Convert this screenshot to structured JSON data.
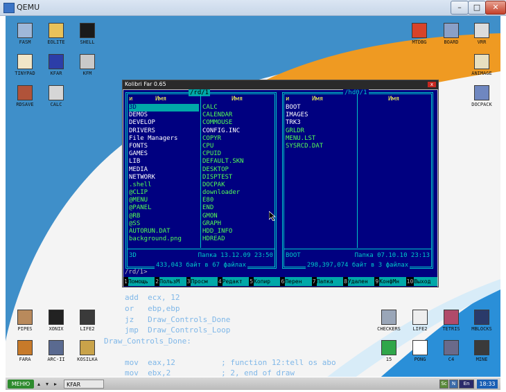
{
  "host": {
    "title": "QEMU",
    "minimize": "–",
    "maximize": "□",
    "close": "✕"
  },
  "desktop_icons": [
    {
      "label": "FASM",
      "icon": "fasm-icon",
      "color": "#9fb8d9"
    },
    {
      "label": "EOLITE",
      "icon": "folder-icon",
      "color": "#e8c25a"
    },
    {
      "label": "SHELL",
      "icon": "terminal-icon",
      "color": "#1a1a1a"
    },
    {
      "label": "TINYPAD",
      "icon": "notepad-icon",
      "color": "#f1e6c8"
    },
    {
      "label": "KFAR",
      "icon": "kfar-icon",
      "color": "#2c3ea8"
    },
    {
      "label": "KFM",
      "icon": "kfm-icon",
      "color": "#c9c9c9"
    },
    {
      "label": "RDSAVE",
      "icon": "disk-save-icon",
      "color": "#b0533a"
    },
    {
      "label": "CALC",
      "icon": "calculator-icon",
      "color": "#d6d6d6"
    },
    {
      "label": "MTDBG",
      "icon": "debugger-icon",
      "color": "#d9432a"
    },
    {
      "label": "BOARD",
      "icon": "board-icon",
      "color": "#8aa0c8"
    },
    {
      "label": "VRR",
      "icon": "monitor-icon",
      "color": "#dcdcdc"
    },
    {
      "label": "ANIMAGE",
      "icon": "paint-icon",
      "color": "#e8e0c0"
    },
    {
      "label": "DOCPACK",
      "icon": "docpack-icon",
      "color": "#6f87c0"
    },
    {
      "label": "PIPES",
      "icon": "pipes-icon",
      "color": "#b98a5c"
    },
    {
      "label": "XONIX",
      "icon": "xonix-icon",
      "color": "#222222"
    },
    {
      "label": "LIFE2",
      "icon": "life-icon",
      "color": "#3a3a3a"
    },
    {
      "label": "FARA",
      "icon": "fara-icon",
      "color": "#c77a2a"
    },
    {
      "label": "ARC-II",
      "icon": "arcanii-icon",
      "color": "#5a6a90"
    },
    {
      "label": "KOSILKA",
      "icon": "kosilka-icon",
      "color": "#c9a34a"
    },
    {
      "label": "CHECKERS",
      "icon": "checkers-icon",
      "color": "#9aa6b8"
    },
    {
      "label": "LIFE2",
      "icon": "life2-icon",
      "color": "#eeeeee"
    },
    {
      "label": "TETRIS",
      "icon": "tetris-icon",
      "color": "#b04a6a"
    },
    {
      "label": "MBLOCKS",
      "icon": "mblocks-icon",
      "color": "#2a3a6a"
    },
    {
      "label": "15",
      "icon": "fifteen-icon",
      "color": "#2fa64a"
    },
    {
      "label": "PONG",
      "icon": "pong-icon",
      "color": "#ffffff"
    },
    {
      "label": "C4",
      "icon": "c4-icon",
      "color": "#6a6a8a"
    },
    {
      "label": "MINE",
      "icon": "mine-icon",
      "color": "#3a3a3a"
    }
  ],
  "bg_code": [
    "add  ecx, 12",
    "or   ebp,ebp",
    "jz   Draw_Controls_Done",
    "jmp  Draw_Controls_Loop",
    "Draw_Controls_Done:",
    "mov  eax,12          ; function 12:tell os abo",
    "mov  ebx,2           ; 2, end of draw"
  ],
  "far": {
    "title": "Kolibri Far 0.65",
    "close": "x",
    "left": {
      "path": "/rd/1",
      "col_marker": "и",
      "col_name": "Имя",
      "col1": [
        {
          "name": "3D",
          "cls": "cursor"
        },
        {
          "name": "DEMOS",
          "cls": "white"
        },
        {
          "name": "DEVELOP",
          "cls": "white"
        },
        {
          "name": "DRIVERS",
          "cls": "white"
        },
        {
          "name": "File Managers",
          "cls": "white"
        },
        {
          "name": "FONTS",
          "cls": "white"
        },
        {
          "name": "GAMES",
          "cls": "white"
        },
        {
          "name": "LIB",
          "cls": "white"
        },
        {
          "name": "MEDIA",
          "cls": "white"
        },
        {
          "name": "NETWORK",
          "cls": "white"
        },
        {
          "name": ".shell",
          "cls": "green"
        },
        {
          "name": "@CLIP",
          "cls": "green"
        },
        {
          "name": "@MENU",
          "cls": "green"
        },
        {
          "name": "@PANEL",
          "cls": "green"
        },
        {
          "name": "@RB",
          "cls": "green"
        },
        {
          "name": "@SS",
          "cls": "green"
        },
        {
          "name": "AUTORUN.DAT",
          "cls": "green"
        },
        {
          "name": "background.png",
          "cls": "green"
        }
      ],
      "col2": [
        {
          "name": "CALC",
          "cls": "green"
        },
        {
          "name": "CALENDAR",
          "cls": "green"
        },
        {
          "name": "COMMOUSE",
          "cls": "green"
        },
        {
          "name": "CONFIG.INC",
          "cls": "white"
        },
        {
          "name": "COPYR",
          "cls": "green"
        },
        {
          "name": "CPU",
          "cls": "green"
        },
        {
          "name": "CPUID",
          "cls": "green"
        },
        {
          "name": "DEFAULT.SKN",
          "cls": "green"
        },
        {
          "name": "DESKTOP",
          "cls": "green"
        },
        {
          "name": "DISPTEST",
          "cls": "green"
        },
        {
          "name": "DOCPAK",
          "cls": "green"
        },
        {
          "name": "downloader",
          "cls": "green"
        },
        {
          "name": "E80",
          "cls": "green"
        },
        {
          "name": "END",
          "cls": "green"
        },
        {
          "name": "GMON",
          "cls": "green"
        },
        {
          "name": "GRAPH",
          "cls": "green"
        },
        {
          "name": "HDD_INFO",
          "cls": "green"
        },
        {
          "name": "HDREAD",
          "cls": "green"
        }
      ],
      "status_name": "3D",
      "status_info": "Папка 13.12.09 23:50",
      "footer": "433,043 байт в 67 файлах"
    },
    "right": {
      "path": "/hd0/1",
      "col_marker": "и",
      "col_name": "Имя",
      "col1": [
        {
          "name": "BOOT",
          "cls": "white"
        },
        {
          "name": "IMAGES",
          "cls": "white"
        },
        {
          "name": "TRK3",
          "cls": "white"
        },
        {
          "name": "GRLDR",
          "cls": "green"
        },
        {
          "name": "MENU.LST",
          "cls": "green"
        },
        {
          "name": "SYSRCD.DAT",
          "cls": "green"
        }
      ],
      "status_name": "BOOT",
      "status_info": "Папка 07.10.10 23:13",
      "footer": "298,397,074 байт в 3 файлах"
    },
    "cmdline": "/rd/1>",
    "keys": [
      {
        "num": "1",
        "label": "Помощь"
      },
      {
        "num": "2",
        "label": "ПользМ"
      },
      {
        "num": "3",
        "label": "Просм"
      },
      {
        "num": "4",
        "label": "Редакт"
      },
      {
        "num": "5",
        "label": "Копир"
      },
      {
        "num": "6",
        "label": "Перен"
      },
      {
        "num": "7",
        "label": "Папка"
      },
      {
        "num": "8",
        "label": "Удален"
      },
      {
        "num": "9",
        "label": "КонфМн"
      },
      {
        "num": "10",
        "label": "Выход"
      }
    ]
  },
  "taskbar": {
    "menu": "МЕНЮ",
    "task": "KFAR",
    "tray": [
      "Sc",
      "N",
      "En"
    ],
    "clock": "18:33"
  }
}
